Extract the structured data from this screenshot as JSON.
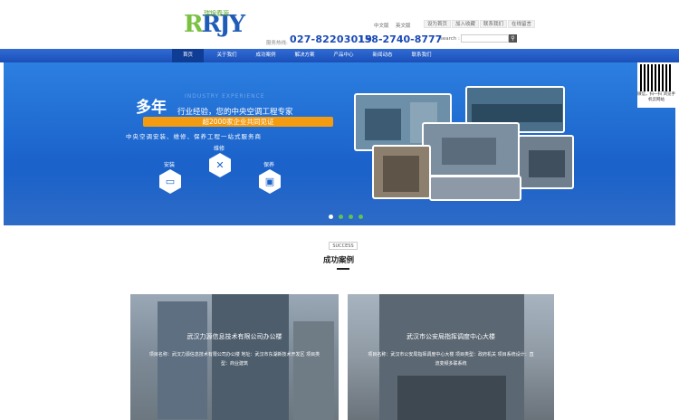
{
  "header": {
    "logo_text": "RJY",
    "logo_sub": "瑞锦春源",
    "lang_cn": "中文版",
    "lang_en": "英文版",
    "links": [
      "设为首页",
      "加入收藏",
      "联系我们",
      "在线留言"
    ],
    "phone_label": "服务热线:",
    "phone1": "027-82203019",
    "phone2": "158-2740-8777",
    "search_label": "search :",
    "search_placeholder": ""
  },
  "nav": {
    "items": [
      "首页",
      "关于我们",
      "成功案例",
      "解决方案",
      "产品中心",
      "新闻动态",
      "联系我们"
    ]
  },
  "hero": {
    "big": "多年",
    "en": "INDUSTRY EXPERIENCE",
    "title": "行业经验，您的中央空调工程专家",
    "yellow": "超2000家企业共同见证",
    "service": "中央空调安装、维修、保养工程一站式服务商",
    "icons": [
      {
        "label": "安装",
        "icon": "install-icon"
      },
      {
        "label": "维修",
        "icon": "repair-icon"
      },
      {
        "label": "保养",
        "icon": "maintain-icon"
      }
    ]
  },
  "qr": {
    "text": "微信，扫一扫\n浏览手机云网站"
  },
  "section": {
    "tag": "SUCCESS",
    "title": "成功案例"
  },
  "cases": [
    {
      "title": "武汉力源信息技术有限公司办公楼",
      "desc": "项目名称：武汉力源信息技术有限公司办公楼 地址：武汉市东湖新技术开发区 项目类型：商业建筑"
    },
    {
      "title": "武汉市公安局指挥调度中心大楼",
      "desc": "项目名称：武汉市公安局指挥调度中心大楼 项目类型：政府机关 项目系统设计：直流变频多联系统"
    }
  ],
  "colors": {
    "brand_blue": "#1b63cb",
    "accent_orange": "#f39c12",
    "dot_green": "#5cc44f"
  }
}
